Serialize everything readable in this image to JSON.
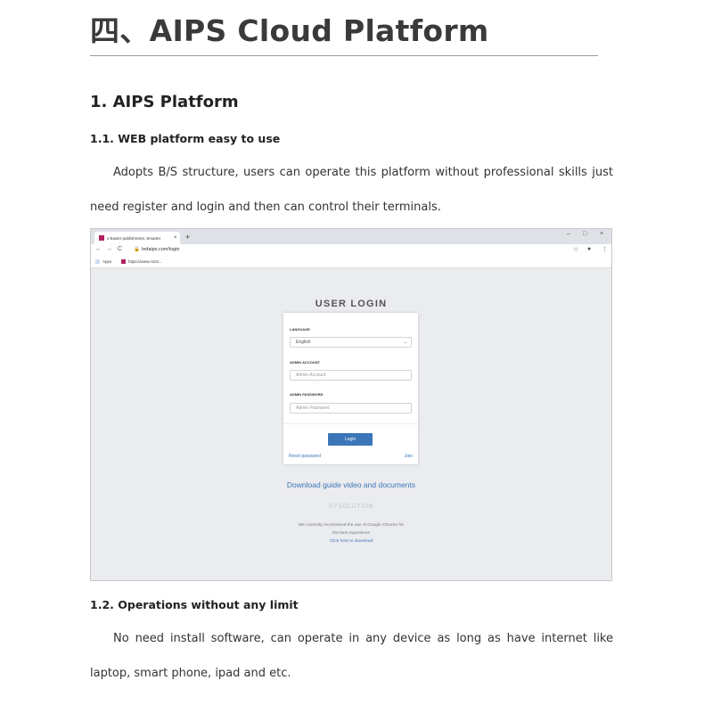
{
  "doc": {
    "main_heading": "四、AIPS Cloud Platform",
    "section1_heading": "1. AIPS Platform",
    "sub1_heading": "1.1.  WEB platform easy to use",
    "para1": "Adopts B/S structure, users can operate this platform without professional skills just need register and login and then can control their terminals.",
    "sub2_heading": "1.2.  Operations without any limit",
    "para2": "No need install software, can operate in any device as long as have internet like laptop, smart phone, ipad and etc."
  },
  "browser": {
    "tab_title": "s Easier publishment, Smarter",
    "tab_close": "×",
    "new_tab": "+",
    "win_min": "–",
    "win_max": "□",
    "win_close": "×",
    "nav_back": "←",
    "nav_forward": "→",
    "nav_reload": "C",
    "url": "ledaips.com/login",
    "star": "☆",
    "account": "●",
    "menu": "⋮",
    "bookmarks": [
      {
        "label": "Apps"
      },
      {
        "label": "https://www.m2m..."
      }
    ]
  },
  "login": {
    "title": "USER   LOGIN",
    "language_label": "LANGUAGE",
    "language_value": "English",
    "account_label": "ADMIN   ACCOUNT",
    "account_placeholder": "Admin   Account",
    "password_label": "ADMIN   PASSWORD",
    "password_placeholder": "Admin   Password",
    "login_button": "Login",
    "reset_link": "Reset   password",
    "join_link": "Join",
    "download_link": "Download guide video and documents",
    "brand": "SYSOLUTION",
    "recommend_line1": "We currently recommend the use of Google Chrome for",
    "recommend_line2": "the best experience",
    "recommend_link": "Click here to download"
  }
}
